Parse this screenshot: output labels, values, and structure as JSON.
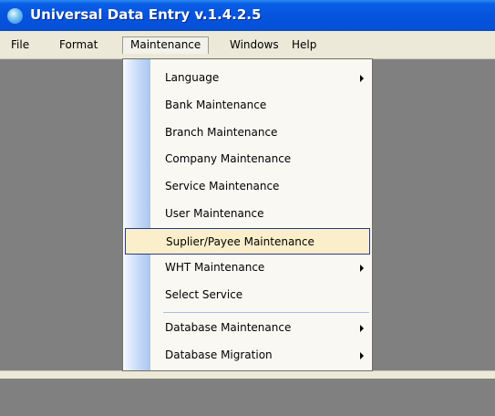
{
  "window": {
    "title": "Universal Data Entry v.1.4.2.5"
  },
  "menubar": {
    "items": [
      "File",
      "Format",
      "Maintenance",
      "Windows",
      "Help"
    ]
  },
  "maintenance_menu": {
    "items": [
      {
        "label": "Language",
        "submenu": true
      },
      {
        "label": "Bank Maintenance",
        "submenu": false
      },
      {
        "label": "Branch Maintenance",
        "submenu": false
      },
      {
        "label": "Company Maintenance",
        "submenu": false
      },
      {
        "label": "Service Maintenance",
        "submenu": false
      },
      {
        "label": "User Maintenance",
        "submenu": false
      },
      {
        "label": "Suplier/Payee Maintenance",
        "submenu": false,
        "highlighted": true
      },
      {
        "label": "WHT Maintenance",
        "submenu": true
      },
      {
        "label": "Select Service",
        "submenu": false
      },
      {
        "label": "Database Maintenance",
        "submenu": true
      },
      {
        "label": "Database Migration",
        "submenu": true
      }
    ]
  },
  "colors": {
    "titlebar": "#0553dd",
    "client_area": "#808080",
    "menu_highlight": "#fbefcb",
    "menu_highlight_border": "#2a3a86"
  }
}
